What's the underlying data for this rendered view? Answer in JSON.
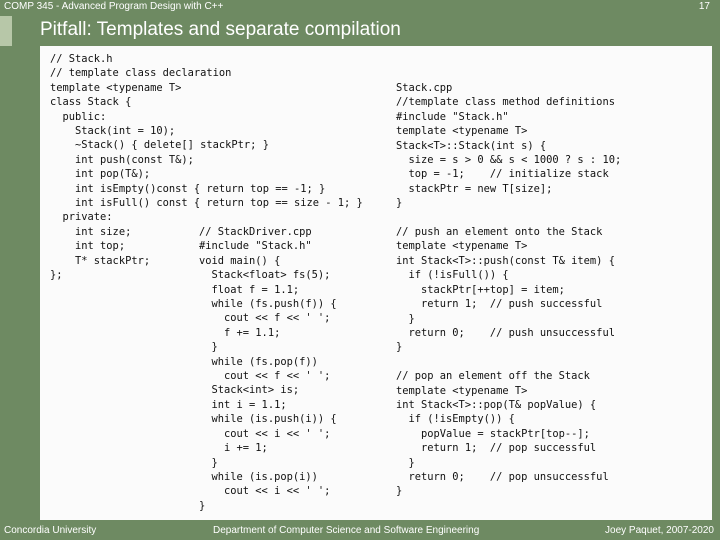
{
  "header": {
    "course": "COMP 345 - Advanced Program Design with C++",
    "page_number": "17"
  },
  "slide": {
    "title": "Pitfall: Templates and separate compilation"
  },
  "code_blocks": {
    "stack_h": "// Stack.h\n// template class declaration\ntemplate <typename T>\nclass Stack {\n  public:\n    Stack(int = 10);\n    ~Stack() { delete[] stackPtr; }\n    int push(const T&);\n    int pop(T&);\n    int isEmpty()const { return top == -1; }\n    int isFull() const { return top == size - 1; }\n  private:\n    int size;\n    int top;\n    T* stackPtr;\n};",
    "stack_driver": "// StackDriver.cpp\n#include \"Stack.h\"\nvoid main() {\n  Stack<float> fs(5);\n  float f = 1.1;\n  while (fs.push(f)) {\n    cout << f << ' ';\n    f += 1.1;\n  }\n  while (fs.pop(f))\n    cout << f << ' ';\n  Stack<int> is;\n  int i = 1.1;\n  while (is.push(i)) {\n    cout << i << ' ';\n    i += 1;\n  }\n  while (is.pop(i))\n    cout << i << ' ';\n}",
    "stack_cpp": "Stack.cpp\n//template class method definitions\n#include \"Stack.h\"\ntemplate <typename T>\nStack<T>::Stack(int s) {\n  size = s > 0 && s < 1000 ? s : 10;\n  top = -1;    // initialize stack\n  stackPtr = new T[size];\n}\n\n// push an element onto the Stack\ntemplate <typename T>\nint Stack<T>::push(const T& item) {\n  if (!isFull()) {\n    stackPtr[++top] = item;\n    return 1;  // push successful\n  }\n  return 0;    // push unsuccessful\n}\n\n// pop an element off the Stack\ntemplate <typename T>\nint Stack<T>::pop(T& popValue) {\n  if (!isEmpty()) {\n    popValue = stackPtr[top--];\n    return 1;  // pop successful\n  }\n  return 0;    // pop unsuccessful\n}"
  },
  "footer": {
    "university": "Concordia University",
    "department": "Department of Computer Science and Software Engineering",
    "author": "Joey Paquet, 2007-2020"
  },
  "colors": {
    "background": "#6e8a62",
    "panel": "#fbfbfb",
    "text": "#ffffff"
  }
}
